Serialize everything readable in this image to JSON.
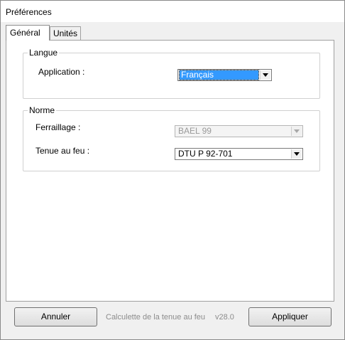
{
  "window": {
    "title": "Préférences"
  },
  "tabs": [
    {
      "label": "Général",
      "active": true
    },
    {
      "label": "Unités",
      "active": false
    }
  ],
  "langue": {
    "legend": "Langue",
    "application_label": "Application :",
    "application_value": "Français",
    "flag_icon": "french-flag-icon"
  },
  "norme": {
    "legend": "Norme",
    "ferraillage_label": "Ferraillage :",
    "ferraillage_value": "BAEL 99",
    "tenue_label": "Tenue au feu :",
    "tenue_value": "DTU P 92-701"
  },
  "footer": {
    "cancel_label": "Annuler",
    "app_name": "Calculette de la tenue au feu",
    "version": "v28.0",
    "apply_label": "Appliquer"
  },
  "colors": {
    "selection": "#3399ff",
    "flag_blue": "#1f3fb0",
    "flag_red": "#e0201e"
  }
}
